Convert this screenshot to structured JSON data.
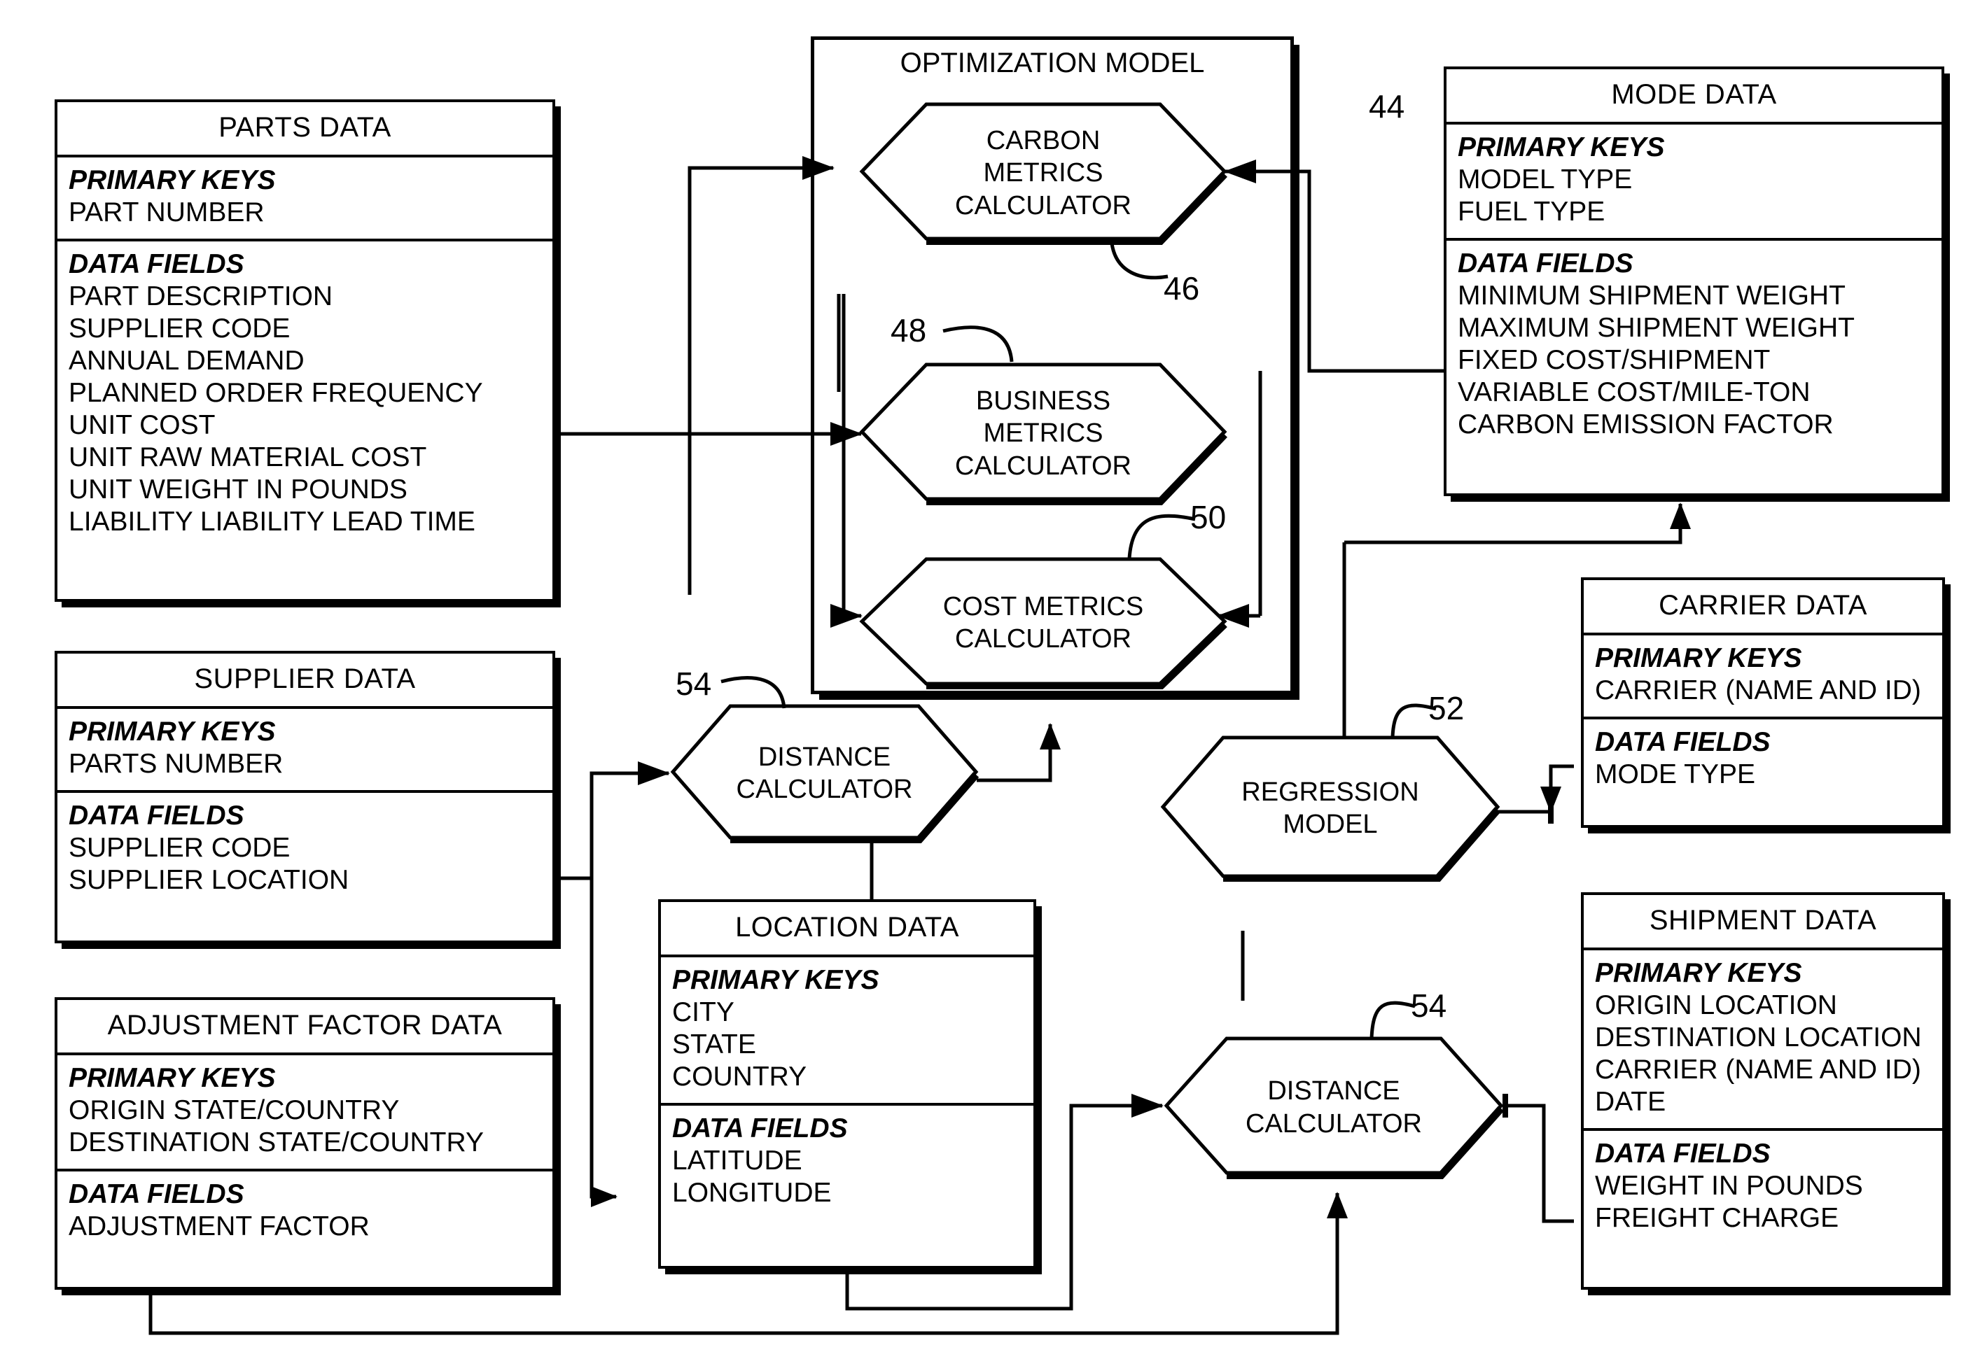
{
  "diagram": {
    "title_block": "OPTIMIZATION MODEL",
    "entities": {
      "parts": {
        "title": "PARTS DATA",
        "primary_keys_label": "PRIMARY KEYS",
        "primary_keys": [
          "PART NUMBER"
        ],
        "data_fields_label": "DATA FIELDS",
        "data_fields": [
          "PART DESCRIPTION",
          "SUPPLIER CODE",
          "ANNUAL DEMAND",
          "PLANNED ORDER FREQUENCY",
          "UNIT COST",
          "UNIT RAW MATERIAL COST",
          "UNIT WEIGHT IN POUNDS",
          "LIABILITY LIABILITY LEAD TIME"
        ]
      },
      "supplier": {
        "title": "SUPPLIER DATA",
        "primary_keys_label": "PRIMARY KEYS",
        "primary_keys": [
          "PARTS NUMBER"
        ],
        "data_fields_label": "DATA FIELDS",
        "data_fields": [
          "SUPPLIER CODE",
          "SUPPLIER LOCATION"
        ]
      },
      "adjustment": {
        "title": "ADJUSTMENT FACTOR DATA",
        "primary_keys_label": "PRIMARY KEYS",
        "primary_keys": [
          "ORIGIN  STATE/COUNTRY",
          "DESTINATION STATE/COUNTRY"
        ],
        "data_fields_label": "DATA FIELDS",
        "data_fields": [
          "ADJUSTMENT FACTOR"
        ]
      },
      "location": {
        "title": "LOCATION DATA",
        "primary_keys_label": "PRIMARY KEYS",
        "primary_keys": [
          "CITY",
          "STATE",
          "COUNTRY"
        ],
        "data_fields_label": "DATA FIELDS",
        "data_fields": [
          "LATITUDE",
          "LONGITUDE"
        ]
      },
      "mode": {
        "title": "MODE DATA",
        "primary_keys_label": "PRIMARY KEYS",
        "primary_keys": [
          "MODEL TYPE",
          "FUEL TYPE"
        ],
        "data_fields_label": "DATA FIELDS",
        "data_fields": [
          "MINIMUM SHIPMENT WEIGHT",
          "MAXIMUM SHIPMENT WEIGHT",
          "FIXED COST/SHIPMENT",
          "VARIABLE COST/MILE-TON",
          "CARBON EMISSION FACTOR"
        ]
      },
      "carrier": {
        "title": "CARRIER DATA",
        "primary_keys_label": "PRIMARY KEYS",
        "primary_keys": [
          "CARRIER (NAME AND ID)"
        ],
        "data_fields_label": "DATA FIELDS",
        "data_fields": [
          "MODE TYPE"
        ]
      },
      "shipment": {
        "title": "SHIPMENT DATA",
        "primary_keys_label": "PRIMARY KEYS",
        "primary_keys": [
          "ORIGIN LOCATION",
          "DESTINATION LOCATION",
          "CARRIER (NAME AND ID)",
          "DATE"
        ],
        "data_fields_label": "DATA FIELDS",
        "data_fields": [
          "WEIGHT IN POUNDS",
          "FREIGHT CHARGE"
        ]
      }
    },
    "processes": {
      "carbon_metrics": [
        "CARBON",
        "METRICS",
        "CALCULATOR"
      ],
      "business_metrics": [
        "BUSINESS",
        "METRICS",
        "CALCULATOR"
      ],
      "cost_metrics": [
        "COST METRICS",
        "CALCULATOR"
      ],
      "distance_calculator_left": [
        "DISTANCE",
        "CALCULATOR"
      ],
      "regression_model": [
        "REGRESSION",
        "MODEL"
      ],
      "distance_calculator_right": [
        "DISTANCE",
        "CALCULATOR"
      ]
    },
    "reference_numerals": {
      "model": "44",
      "carbon": "46",
      "business": "48",
      "cost": "50",
      "regression": "52",
      "distance_left": "54",
      "distance_right": "54"
    },
    "colors": {
      "ink": "#000000",
      "paper": "#ffffff"
    }
  }
}
